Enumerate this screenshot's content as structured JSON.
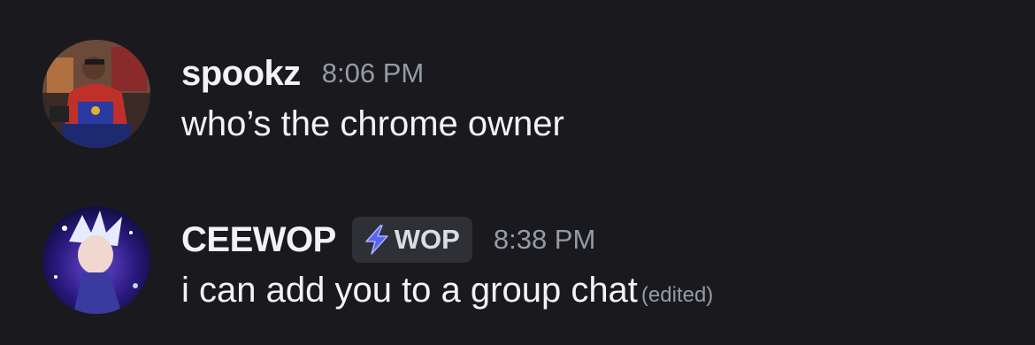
{
  "messages": [
    {
      "username": "spookz",
      "timestamp": "8:06 PM",
      "content": "who’s the chrome owner",
      "avatar": "profile-photo"
    },
    {
      "username": "CEEWOP",
      "timestamp": "8:38 PM",
      "tag": {
        "label": "WOP",
        "icon": "lightning-bolt-icon"
      },
      "content": "i can add you to a group chat",
      "edited_label": "(edited)",
      "avatar": "anime-character-avatar"
    }
  ],
  "colors": {
    "background": "#1a1a1e",
    "username": "#f2f3f5",
    "timestamp": "#949ba4",
    "message_text": "#f2f3f5",
    "tag_background": "#2f3035",
    "tag_icon": "#5865f2"
  }
}
